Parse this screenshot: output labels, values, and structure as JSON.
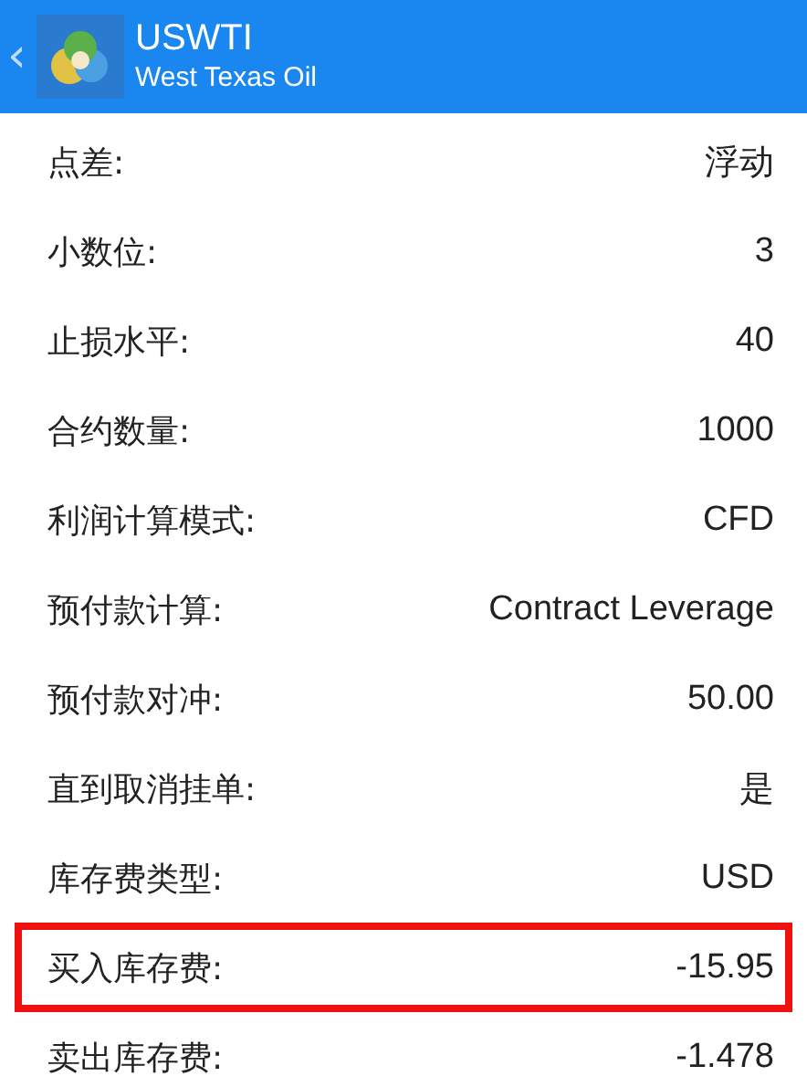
{
  "header": {
    "title": "USWTI",
    "subtitle": "West Texas Oil",
    "back": "‹"
  },
  "rows": [
    {
      "label": "点差:",
      "value": "浮动",
      "highlighted": false
    },
    {
      "label": "小数位:",
      "value": "3",
      "highlighted": false
    },
    {
      "label": "止损水平:",
      "value": "40",
      "highlighted": false
    },
    {
      "label": "合约数量:",
      "value": "1000",
      "highlighted": false
    },
    {
      "label": "利润计算模式:",
      "value": "CFD",
      "highlighted": false
    },
    {
      "label": "预付款计算:",
      "value": "Contract Leverage",
      "highlighted": false
    },
    {
      "label": "预付款对冲:",
      "value": "50.00",
      "highlighted": false
    },
    {
      "label": "直到取消挂单:",
      "value": "是",
      "highlighted": false
    },
    {
      "label": "库存费类型:",
      "value": "USD",
      "highlighted": false
    },
    {
      "label": "买入库存费:",
      "value": "-15.95",
      "highlighted": true
    },
    {
      "label": "卖出库存费:",
      "value": "-1.478",
      "highlighted": false
    }
  ]
}
